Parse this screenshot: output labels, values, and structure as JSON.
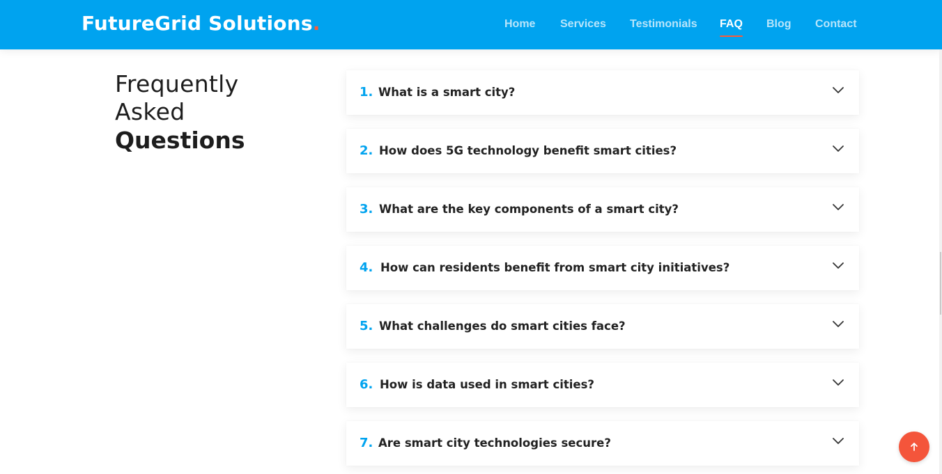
{
  "brand": {
    "name": "FutureGrid Solutions",
    "dot": "."
  },
  "nav": {
    "items": [
      {
        "label": "Home"
      },
      {
        "label": "Services"
      },
      {
        "label": "Testimonials"
      },
      {
        "label": "FAQ",
        "active": true
      },
      {
        "label": "Blog"
      },
      {
        "label": "Contact"
      }
    ]
  },
  "section": {
    "title_line1": "Frequently",
    "title_line2": "Asked",
    "title_strong": "Questions"
  },
  "faq": [
    {
      "num": "1.",
      "question": "What is a smart city?"
    },
    {
      "num": "2.",
      "question": "How does 5G technology benefit smart cities?"
    },
    {
      "num": "3.",
      "question": "What are the key components of a smart city?"
    },
    {
      "num": "4.",
      "question": "How can residents benefit from smart city initiatives?"
    },
    {
      "num": "5.",
      "question": "What challenges do smart cities face?"
    },
    {
      "num": "6.",
      "question": "How is data used in smart cities?"
    },
    {
      "num": "7.",
      "question": "Are smart city technologies secure?"
    }
  ],
  "icons": {
    "faq_toggle": "chevron-down-icon",
    "scroll_top": "arrow-up-icon"
  },
  "colors": {
    "header": "#00a3ef",
    "accent": "#ff5a36",
    "number": "#00a3ef",
    "scroll_button": "#f4553b"
  }
}
